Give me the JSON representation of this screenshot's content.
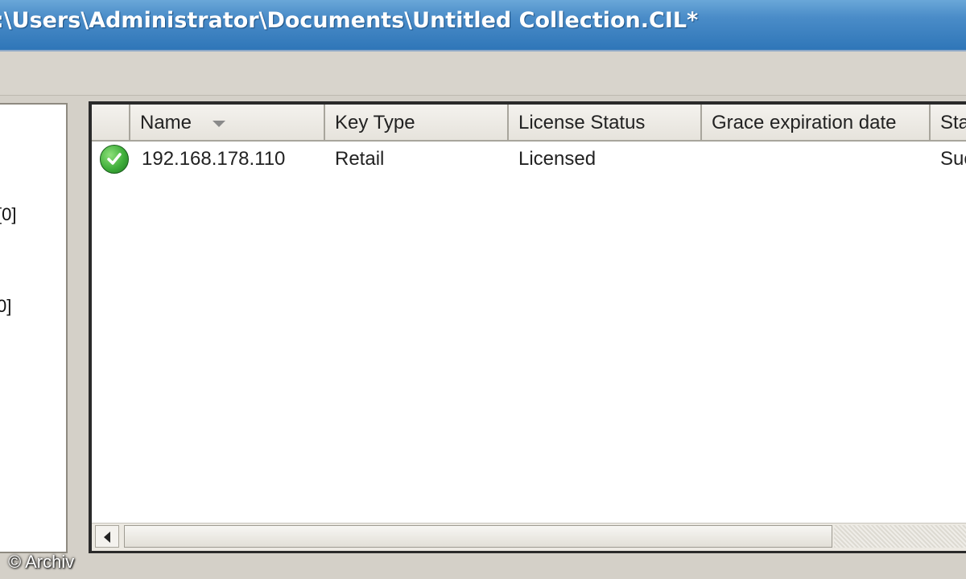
{
  "window": {
    "title": ":\\Users\\Administrator\\Documents\\Untitled Collection.CIL*"
  },
  "left_pane": {
    "items": [
      "[0]",
      "0]"
    ]
  },
  "table": {
    "columns": [
      "Name",
      "Key Type",
      "License Status",
      "Grace expiration date",
      "Sta"
    ],
    "sort_column": "Name",
    "rows": [
      {
        "status_icon": "green-check-icon",
        "name": "192.168.178.110",
        "key_type": "Retail",
        "license_status": "Licensed",
        "grace_expiration_date": "",
        "status": "Suc"
      }
    ]
  },
  "watermark": "© Archiv",
  "colors": {
    "titlebar": "#3a7fc1",
    "window_bg": "#d4d0c8",
    "status_ok": "#3fae3a"
  }
}
